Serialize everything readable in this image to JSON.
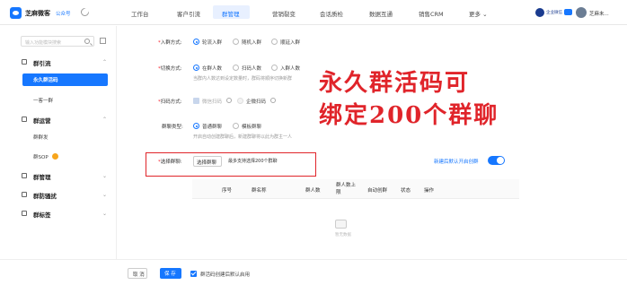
{
  "nav": {
    "brand": "芝麻微客",
    "brand_sub": "公众号",
    "items": [
      "工作台",
      "客户引流",
      "群管理",
      "营销裂变",
      "会话质检",
      "数据互通",
      "销售CRM",
      "更多 ⌄"
    ],
    "active_index": 2,
    "user_tag": "企业微信",
    "user_name": "芝麻未..."
  },
  "sidebar": {
    "search_placeholder": "输入功能模块搜索",
    "groups": [
      {
        "label": "群引流",
        "expanded": true,
        "items": [
          "永久群活码",
          "一客一群"
        ],
        "active_item": 0
      },
      {
        "label": "群运营",
        "expanded": true,
        "items": [
          "群群发",
          "群SOP"
        ]
      },
      {
        "label": "群管理",
        "expanded": false,
        "items": []
      },
      {
        "label": "群防骚扰",
        "expanded": false,
        "items": []
      },
      {
        "label": "群标签",
        "expanded": false,
        "items": []
      }
    ]
  },
  "form": {
    "join_mode": {
      "label": "入群方式:",
      "options": [
        "轮流入群",
        "随机入群",
        "顺延入群"
      ],
      "selected": 0
    },
    "switch_mode": {
      "label": "切换方式:",
      "options": [
        "在群人数",
        "扫码人数",
        "入群人数"
      ],
      "selected": 0,
      "hint": "当群内人数达到设定数量时，群码将顺序切换新群"
    },
    "scan_mode": {
      "label": "扫码方式:",
      "options": [
        "微信扫码",
        "企微扫码"
      ]
    },
    "group_type": {
      "label": "群聊类型:",
      "options": [
        "普通群聊",
        "模板群聊"
      ],
      "selected": 0,
      "hint": "开启自动创建群聊后，新建群聊将以此为群主一人"
    },
    "select_group": {
      "label": "选择群聊:",
      "button": "选择群聊",
      "hint": "最多支持选择200个群聊"
    },
    "auto_create_label": "新建后默认开启创群"
  },
  "table": {
    "columns": [
      "序号",
      "群名称",
      "群人数",
      "群人数上限",
      "自动创群",
      "状态",
      "操作"
    ],
    "empty_text": "暂无数据"
  },
  "annotation": {
    "line1": "永久群活码可",
    "line2": "绑定200个群聊"
  },
  "footer": {
    "cancel": "取 消",
    "save": "保 存",
    "checkbox_label": "群活码创建后默认启用"
  }
}
